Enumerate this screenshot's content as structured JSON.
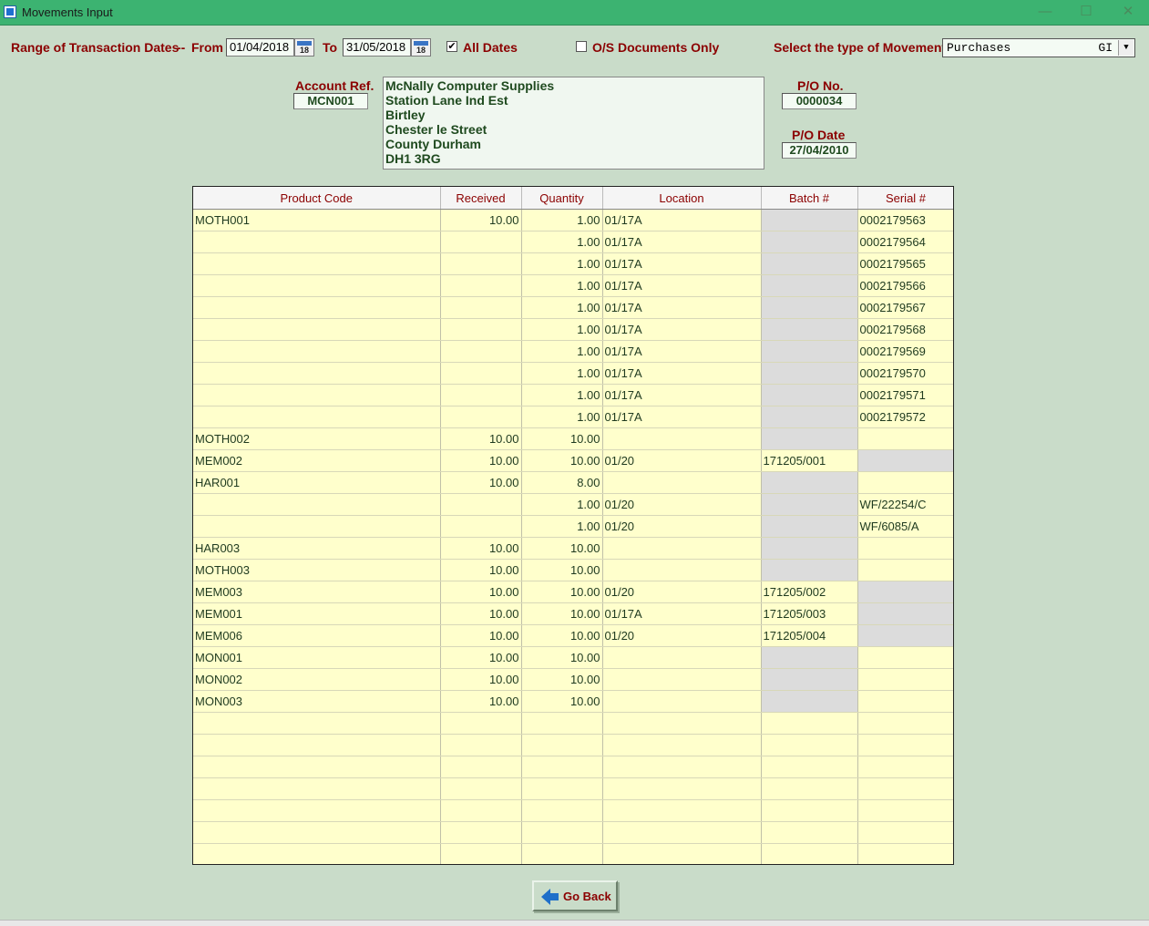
{
  "window": {
    "title": "Movements Input"
  },
  "filters": {
    "range_label": "Range of Transaction Dates",
    "dash": "--",
    "from_label": "From",
    "from_value": "01/04/2018",
    "to_label": "To",
    "to_value": "31/05/2018",
    "calendar_day": "18",
    "all_dates_label": "All Dates",
    "all_dates_checked": "✔",
    "os_docs_label": "O/S Documents Only",
    "movement_type_label": "Select the type of Movement",
    "movement_type_value": "Purchases",
    "movement_type_code": "GI"
  },
  "account": {
    "ref_label": "Account Ref.",
    "ref_value": "MCN001",
    "address": [
      "McNally Computer Supplies",
      "Station Lane Ind Est",
      "Birtley",
      "Chester le Street",
      "County Durham",
      "DH1 3RG"
    ]
  },
  "po": {
    "no_label": "P/O No.",
    "no_value": "0000034",
    "date_label": "P/O Date",
    "date_value": "27/04/2010"
  },
  "grid": {
    "columns": [
      "Product Code",
      "Received",
      "Quantity",
      "Location",
      "Batch #",
      "Serial #"
    ],
    "rows": [
      {
        "code": "MOTH001",
        "received": "10.00",
        "qty": "1.00",
        "location": "01/17A",
        "batch": "",
        "serial": "0002179563",
        "grey": "batch"
      },
      {
        "code": "",
        "received": "",
        "qty": "1.00",
        "location": "01/17A",
        "batch": "",
        "serial": "0002179564",
        "grey": "batch"
      },
      {
        "code": "",
        "received": "",
        "qty": "1.00",
        "location": "01/17A",
        "batch": "",
        "serial": "0002179565",
        "grey": "batch"
      },
      {
        "code": "",
        "received": "",
        "qty": "1.00",
        "location": "01/17A",
        "batch": "",
        "serial": "0002179566",
        "grey": "batch"
      },
      {
        "code": "",
        "received": "",
        "qty": "1.00",
        "location": "01/17A",
        "batch": "",
        "serial": "0002179567",
        "grey": "batch"
      },
      {
        "code": "",
        "received": "",
        "qty": "1.00",
        "location": "01/17A",
        "batch": "",
        "serial": "0002179568",
        "grey": "batch"
      },
      {
        "code": "",
        "received": "",
        "qty": "1.00",
        "location": "01/17A",
        "batch": "",
        "serial": "0002179569",
        "grey": "batch"
      },
      {
        "code": "",
        "received": "",
        "qty": "1.00",
        "location": "01/17A",
        "batch": "",
        "serial": "0002179570",
        "grey": "batch"
      },
      {
        "code": "",
        "received": "",
        "qty": "1.00",
        "location": "01/17A",
        "batch": "",
        "serial": "0002179571",
        "grey": "batch"
      },
      {
        "code": "",
        "received": "",
        "qty": "1.00",
        "location": "01/17A",
        "batch": "",
        "serial": "0002179572",
        "grey": "batch"
      },
      {
        "code": "MOTH002",
        "received": "10.00",
        "qty": "10.00",
        "location": "",
        "batch": "",
        "serial": "",
        "grey": "batch"
      },
      {
        "code": "MEM002",
        "received": "10.00",
        "qty": "10.00",
        "location": "01/20",
        "batch": "171205/001",
        "serial": "",
        "grey": "serial"
      },
      {
        "code": "HAR001",
        "received": "10.00",
        "qty": "8.00",
        "location": "",
        "batch": "",
        "serial": "",
        "grey": "batch"
      },
      {
        "code": "",
        "received": "",
        "qty": "1.00",
        "location": "01/20",
        "batch": "",
        "serial": "WF/22254/C",
        "grey": "batch"
      },
      {
        "code": "",
        "received": "",
        "qty": "1.00",
        "location": "01/20",
        "batch": "",
        "serial": "WF/6085/A",
        "grey": "batch"
      },
      {
        "code": "HAR003",
        "received": "10.00",
        "qty": "10.00",
        "location": "",
        "batch": "",
        "serial": "",
        "grey": "batch"
      },
      {
        "code": "MOTH003",
        "received": "10.00",
        "qty": "10.00",
        "location": "",
        "batch": "",
        "serial": "",
        "grey": "batch"
      },
      {
        "code": "MEM003",
        "received": "10.00",
        "qty": "10.00",
        "location": "01/20",
        "batch": "171205/002",
        "serial": "",
        "grey": "serial"
      },
      {
        "code": "MEM001",
        "received": "10.00",
        "qty": "10.00",
        "location": "01/17A",
        "batch": "171205/003",
        "serial": "",
        "grey": "serial"
      },
      {
        "code": "MEM006",
        "received": "10.00",
        "qty": "10.00",
        "location": "01/20",
        "batch": "171205/004",
        "serial": "",
        "grey": "serial"
      },
      {
        "code": "MON001",
        "received": "10.00",
        "qty": "10.00",
        "location": "",
        "batch": "",
        "serial": "",
        "grey": "batch"
      },
      {
        "code": "MON002",
        "received": "10.00",
        "qty": "10.00",
        "location": "",
        "batch": "",
        "serial": "",
        "grey": "batch"
      },
      {
        "code": "MON003",
        "received": "10.00",
        "qty": "10.00",
        "location": "",
        "batch": "",
        "serial": "",
        "grey": "batch"
      },
      {
        "code": "",
        "received": "",
        "qty": "",
        "location": "",
        "batch": "",
        "serial": "",
        "grey": ""
      },
      {
        "code": "",
        "received": "",
        "qty": "",
        "location": "",
        "batch": "",
        "serial": "",
        "grey": ""
      },
      {
        "code": "",
        "received": "",
        "qty": "",
        "location": "",
        "batch": "",
        "serial": "",
        "grey": ""
      },
      {
        "code": "",
        "received": "",
        "qty": "",
        "location": "",
        "batch": "",
        "serial": "",
        "grey": ""
      },
      {
        "code": "",
        "received": "",
        "qty": "",
        "location": "",
        "batch": "",
        "serial": "",
        "grey": ""
      },
      {
        "code": "",
        "received": "",
        "qty": "",
        "location": "",
        "batch": "",
        "serial": "",
        "grey": ""
      },
      {
        "code": "",
        "received": "",
        "qty": "",
        "location": "",
        "batch": "",
        "serial": "",
        "grey": ""
      }
    ]
  },
  "actions": {
    "go_back_label": "Go Back"
  },
  "window_controls": {
    "minimize": "—",
    "maximize": "☐",
    "close": "✕"
  },
  "colors": {
    "background": "#c9dcc9",
    "titlebar": "#3cb371",
    "label": "#8b0000",
    "grid_row": "#ffffcc",
    "grid_locked": "#dcdcdc"
  }
}
